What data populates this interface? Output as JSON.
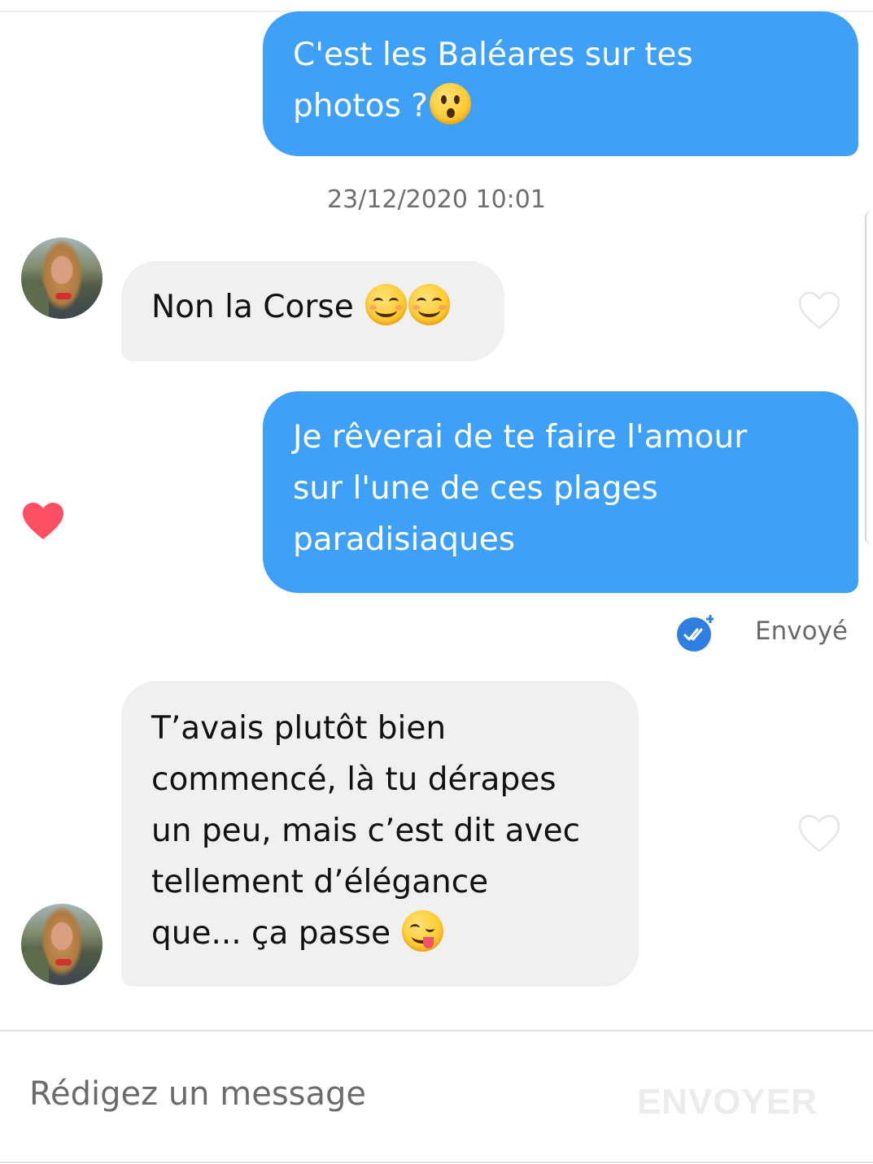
{
  "conversation": {
    "messages": [
      {
        "from": "me",
        "lines": [
          "C'est les Baléares sur tes",
          "photos ?"
        ],
        "emoji": "hushed-face"
      },
      {
        "from": "match",
        "lines": [
          "Non la Corse "
        ],
        "emojis": [
          "relieved-face",
          "relieved-face"
        ]
      },
      {
        "from": "me",
        "lines": [
          "Je rêverai de te faire l'amour",
          "sur l'une de ces plages",
          "paradisiaques"
        ],
        "liked": true
      },
      {
        "from": "match",
        "lines": [
          "T’avais plutôt bien",
          "commencé, là tu dérapes",
          "un peu, mais c’est dit avec",
          "tellement d’élégance",
          "que... ça passe "
        ],
        "emoji": "face-savoring-food"
      }
    ],
    "timestamp": "23/12/2020 10:01",
    "receipt": {
      "label": "Envoyé",
      "icon": "read-receipt-plus-icon"
    }
  },
  "composer": {
    "placeholder": "Rédigez un message",
    "send_label": "ENVOYER"
  },
  "colors": {
    "outgoing_bubble": "#3fa0f7",
    "incoming_bubble": "#f0f0f0",
    "like_heart": "#ff4f62",
    "receipt_blue": "#2f7fe0",
    "send_disabled": "#ececec"
  }
}
